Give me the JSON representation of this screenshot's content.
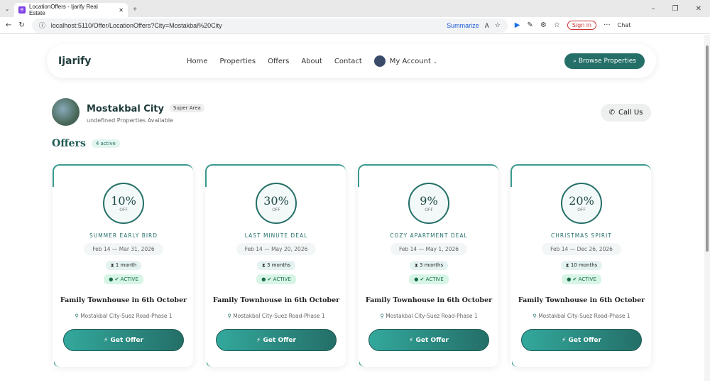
{
  "browser": {
    "tab_title": "LocationOffers - Ijarify Real Estate",
    "url": "localhost:5110/Offer/LocationOffers?City=Mostakbal%20City",
    "summarize": "Summarize",
    "sign_in": "Sign in",
    "chat": "Chat"
  },
  "nav": {
    "logo": "Ijarify",
    "links": [
      "Home",
      "Properties",
      "Offers",
      "About",
      "Contact"
    ],
    "account": "My Account",
    "browse": "Browse Properties"
  },
  "city": {
    "name": "Mostakbal City",
    "badge": "Super Area",
    "subtitle": "undefined Properties Available",
    "call": "Call Us"
  },
  "offers": {
    "heading": "Offers",
    "count": "4 active",
    "cards": [
      {
        "pct": "10%",
        "off": "OFF",
        "name": "SUMMER EARLY BIRD",
        "dates": "Feb 14 — Mar 31, 2026",
        "duration": "1 month",
        "status": "ACTIVE",
        "title": "Family Townhouse in 6th October",
        "location": "Mostakbal City-Suez Road-Phase 1",
        "button": "Get Offer"
      },
      {
        "pct": "30%",
        "off": "OFF",
        "name": "LAST MINUTE DEAL",
        "dates": "Feb 14 — May 20, 2026",
        "duration": "3 months",
        "status": "ACTIVE",
        "title": "Family Townhouse in 6th October",
        "location": "Mostakbal City-Suez Road-Phase 1",
        "button": "Get Offer"
      },
      {
        "pct": "9%",
        "off": "OFF",
        "name": "COZY APARTMENT DEAL",
        "dates": "Feb 14 — May 1, 2026",
        "duration": "3 months",
        "status": "ACTIVE",
        "title": "Family Townhouse in 6th October",
        "location": "Mostakbal City-Suez Road-Phase 1",
        "button": "Get Offer"
      },
      {
        "pct": "20%",
        "off": "OFF",
        "name": "CHRISTMAS SPIRIT",
        "dates": "Feb 14 — Dec 26, 2026",
        "duration": "10 months",
        "status": "ACTIVE",
        "title": "Family Townhouse in 6th October",
        "location": "Mostakbal City-Suez Road-Phase 1",
        "button": "Get Offer"
      }
    ]
  }
}
